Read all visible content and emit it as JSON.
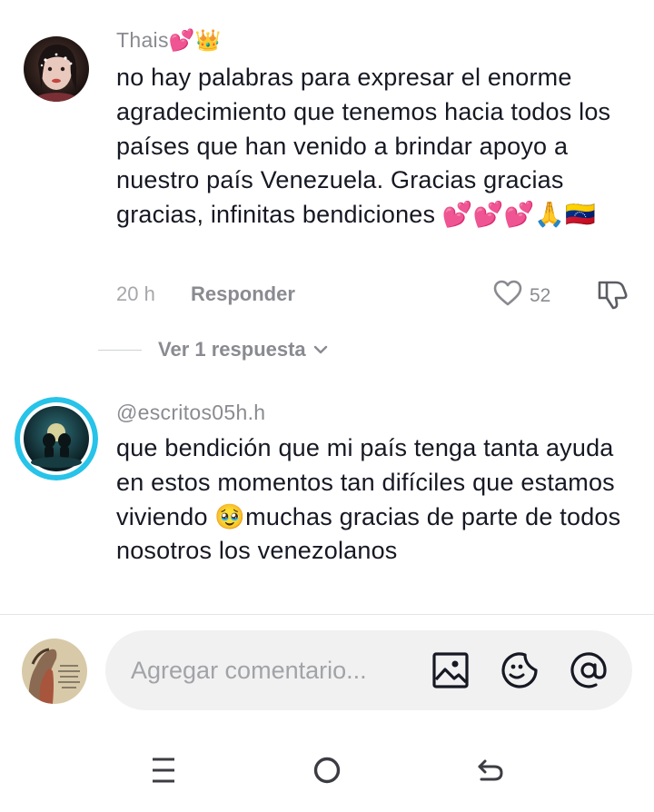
{
  "comments": [
    {
      "username": "Thais💕👑",
      "text": "no hay palabras para expresar el enorme agradecimiento que tenemos hacia todos los países que han venido a brindar apoyo a nuestro país Venezuela. Gracias gracias gracias, infinitas bendiciones 💕💕💕🙏🇻🇪",
      "time": "20 h",
      "reply_label": "Responder",
      "likes": "52"
    },
    {
      "username": "@escritos05h.h",
      "text": "que bendición que mi país tenga tanta ayuda en estos momentos tan difíciles que estamos viviendo 🥹muchas gracias de parte de todos nosotros los venezolanos"
    }
  ],
  "view_replies_label": "Ver 1 respuesta",
  "composer": {
    "placeholder": "Agregar comentario..."
  },
  "icons": {
    "like": "heart-outline-icon",
    "dislike": "thumbs-down-icon",
    "image": "image-icon",
    "emoji": "emoji-icon",
    "mention": "at-mention-icon",
    "chevron": "chevron-down-icon",
    "nav_recent": "recent-apps-icon",
    "nav_home": "home-circle-icon",
    "nav_back": "back-arrow-icon"
  },
  "colors": {
    "accent_ring": "#27c3e8",
    "text_primary": "#161823",
    "text_secondary": "#8a8b91",
    "input_bg": "#f1f1f2"
  }
}
